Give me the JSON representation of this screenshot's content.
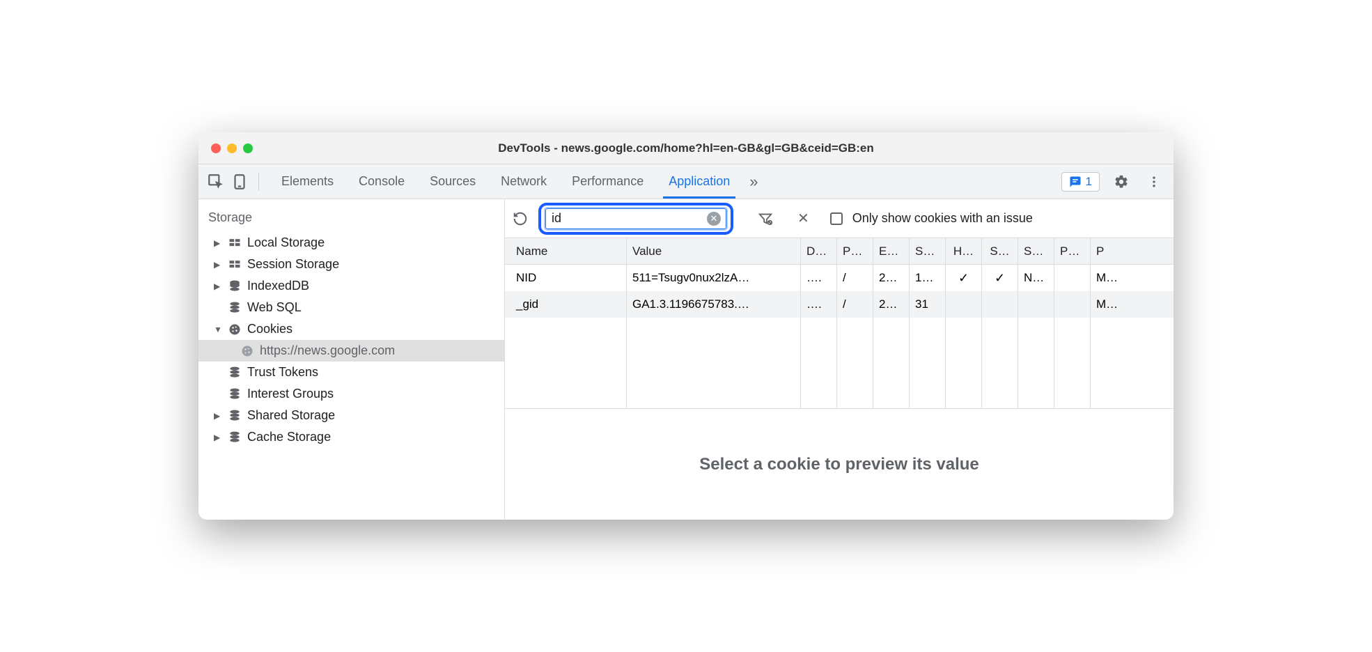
{
  "window": {
    "title": "DevTools - news.google.com/home?hl=en-GB&gl=GB&ceid=GB:en"
  },
  "tabs": {
    "elements": "Elements",
    "console": "Console",
    "sources": "Sources",
    "network": "Network",
    "performance": "Performance",
    "application": "Application",
    "more": "»"
  },
  "badge": {
    "count": "1"
  },
  "sidebar": {
    "heading": "Storage",
    "localStorage": "Local Storage",
    "sessionStorage": "Session Storage",
    "indexedDB": "IndexedDB",
    "webSQL": "Web SQL",
    "cookies": "Cookies",
    "cookieDomain": "https://news.google.com",
    "trustTokens": "Trust Tokens",
    "interestGroups": "Interest Groups",
    "sharedStorage": "Shared Storage",
    "cacheStorage": "Cache Storage"
  },
  "filter": {
    "value": "id",
    "checkboxLabel": "Only show cookies with an issue"
  },
  "columns": {
    "name": "Name",
    "value": "Value",
    "domain": "D…",
    "path": "P…",
    "expires": "E…",
    "size": "S…",
    "httpOnly": "H…",
    "secure": "S…",
    "sameSite": "S…",
    "partition": "P…",
    "priority": "P"
  },
  "rows": [
    {
      "name": "NID",
      "value": "511=Tsugv0nux2lzA…",
      "domain": "….",
      "path": "/",
      "expires": "2…",
      "size": "1…",
      "httpOnly": "✓",
      "secure": "✓",
      "sameSite": "N…",
      "partition": "",
      "priority": "M…"
    },
    {
      "name": "_gid",
      "value": "GA1.3.1196675783.…",
      "domain": "….",
      "path": "/",
      "expires": "2…",
      "size": "31",
      "httpOnly": "",
      "secure": "",
      "sameSite": "",
      "partition": "",
      "priority": "M…"
    }
  ],
  "preview": {
    "text": "Select a cookie to preview its value"
  }
}
